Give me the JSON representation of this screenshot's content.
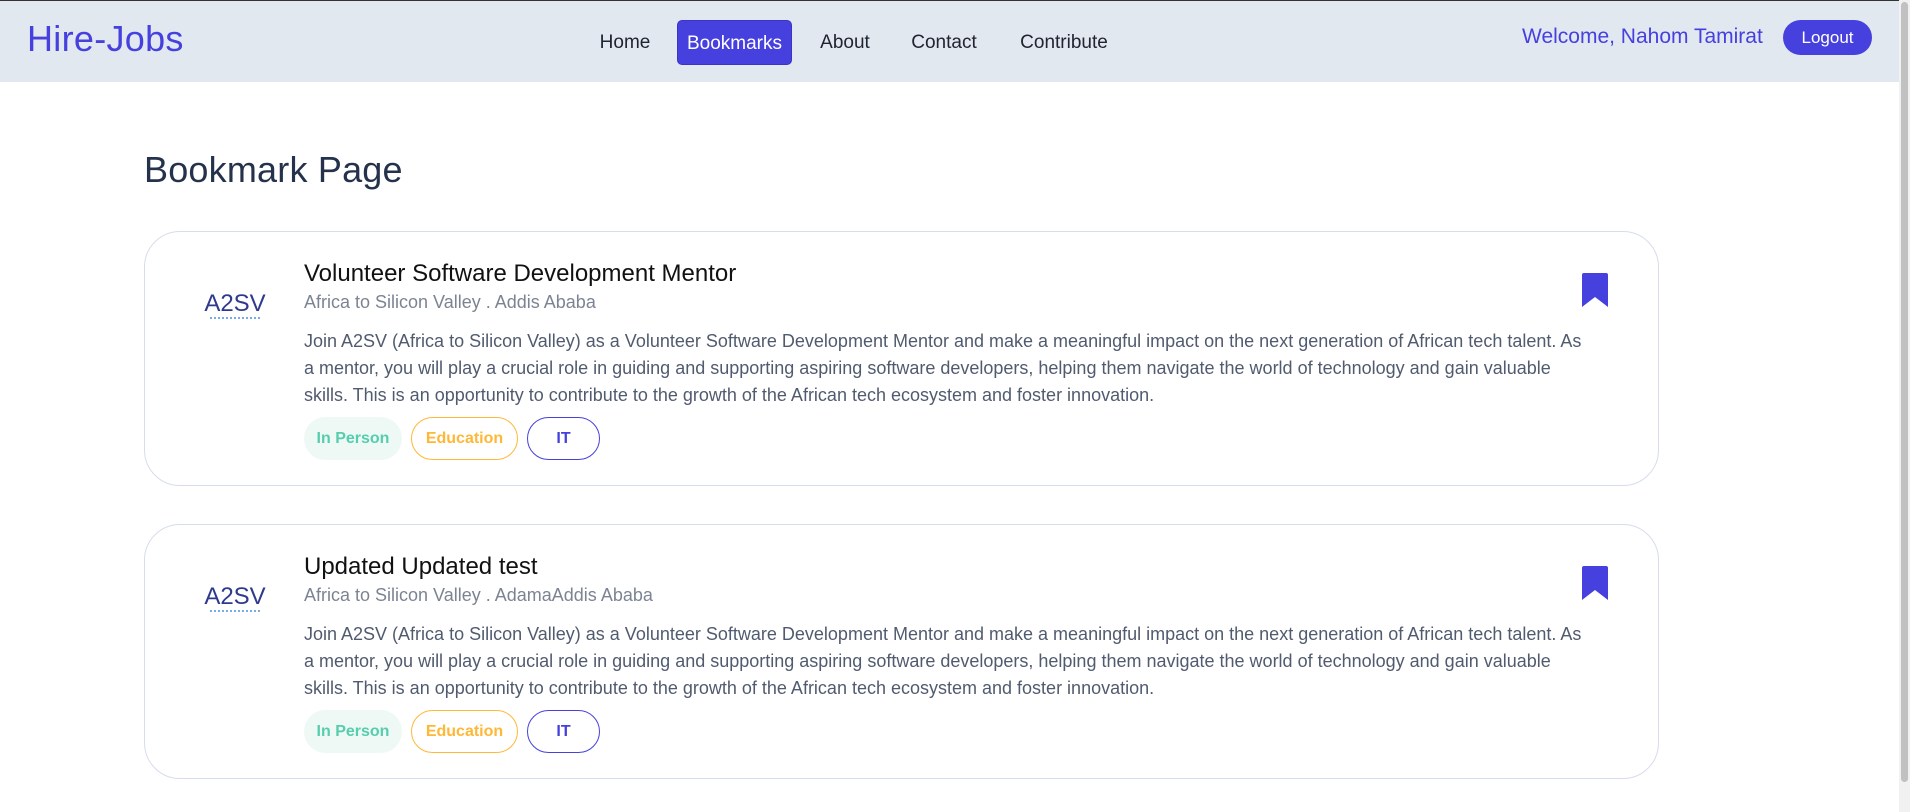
{
  "nav": {
    "brand": "Hire-Jobs",
    "links": [
      "Home",
      "Bookmarks",
      "About",
      "Contact",
      "Contribute"
    ],
    "active": "Bookmarks",
    "welcome": "Welcome, Nahom Tamirat",
    "logout": "Logout"
  },
  "page": {
    "title": "Bookmark Page"
  },
  "jobs": [
    {
      "title": "Volunteer Software Development Mentor",
      "subtitle": "Africa to Silicon Valley . Addis Ababa",
      "description": "Join A2SV (Africa to Silicon Valley) as a Volunteer Software Development Mentor and make a meaningful impact on the next generation of African tech talent. As a mentor, you will play a crucial role in guiding and supporting aspiring software developers, helping them navigate the world of technology and gain valuable skills. This is an opportunity to contribute to the growth of the African tech ecosystem and foster innovation.",
      "tags": [
        "In Person",
        "Education",
        "IT"
      ],
      "logo_text": "A2SV",
      "bookmarked": true
    },
    {
      "title": "Updated Updated test",
      "subtitle": "Africa to Silicon Valley . AdamaAddis Ababa",
      "description": "Join A2SV (Africa to Silicon Valley) as a Volunteer Software Development Mentor and make a meaningful impact on the next generation of African tech talent. As a mentor, you will play a crucial role in guiding and supporting aspiring software developers, helping them navigate the world of technology and gain valuable skills. This is an opportunity to contribute to the growth of the African tech ecosystem and foster innovation.",
      "tags": [
        "In Person",
        "Education",
        "IT"
      ],
      "logo_text": "A2SV",
      "bookmarked": true
    }
  ],
  "colors": {
    "primary": "#4640DE",
    "nav_bg": "#E2E8F0",
    "tag_green": "#56CDAD",
    "tag_orange": "#FFB836"
  },
  "icons": {
    "bookmark": "bookmark-icon",
    "logo": "a2sv-logo"
  }
}
